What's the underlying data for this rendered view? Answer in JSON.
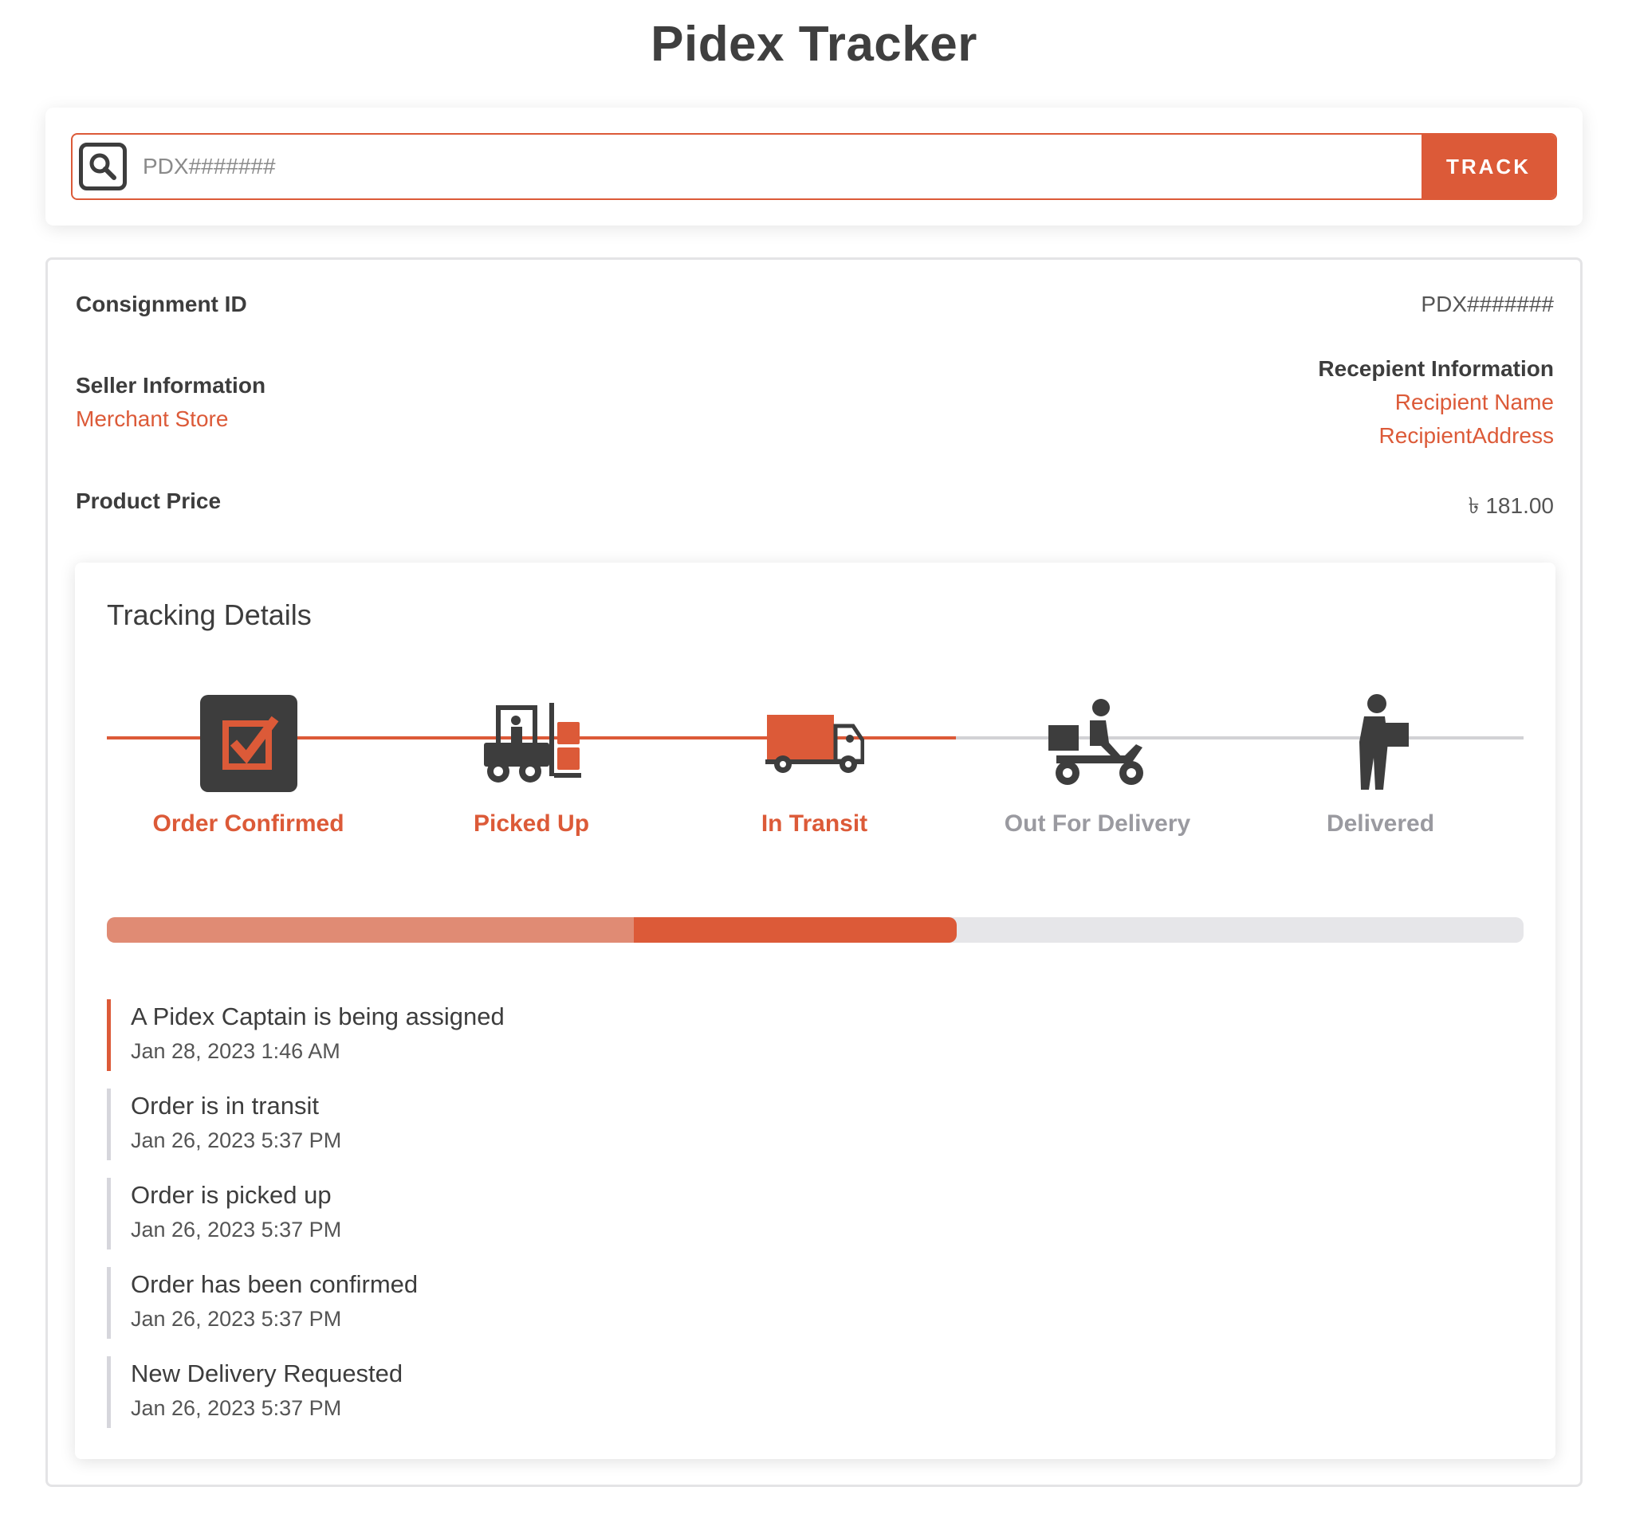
{
  "app": {
    "title": "Pidex Tracker"
  },
  "search": {
    "placeholder": "PDX#######",
    "button_label": "TRACK"
  },
  "details": {
    "consignment_label": "Consignment ID",
    "consignment_value": "PDX#######",
    "seller_label": "Seller Information",
    "seller_name": "Merchant Store",
    "recipient_label": "Recepient Information",
    "recipient_name": "Recipient Name",
    "recipient_address": "RecipientAddress",
    "price_label": "Product Price",
    "price_value": "৳ 181.00"
  },
  "tracking": {
    "title": "Tracking Details",
    "steps": [
      {
        "label": "Order Confirmed",
        "icon": "checkbox-icon",
        "active": true
      },
      {
        "label": "Picked Up",
        "icon": "forklift-icon",
        "active": true
      },
      {
        "label": "In Transit",
        "icon": "truck-icon",
        "active": true
      },
      {
        "label": "Out For Delivery",
        "icon": "scooter-icon",
        "active": false
      },
      {
        "label": "Delivered",
        "icon": "person-box-icon",
        "active": false
      }
    ],
    "progress": {
      "completed_fraction": 0.6,
      "previous_fraction": 0.372
    },
    "history": [
      {
        "title": "A Pidex Captain is being assigned",
        "time": "Jan 28, 2023 1:46 AM"
      },
      {
        "title": "Order is in transit",
        "time": "Jan 26, 2023 5:37 PM"
      },
      {
        "title": "Order is picked up",
        "time": "Jan 26, 2023 5:37 PM"
      },
      {
        "title": "Order has been confirmed",
        "time": "Jan 26, 2023 5:37 PM"
      },
      {
        "title": "New Delivery Requested",
        "time": "Jan 26, 2023 5:37 PM"
      }
    ]
  },
  "colors": {
    "accent": "#dc5a38",
    "accent_light": "#e08b74",
    "dark": "#3d3d3d",
    "muted": "#9a9aa0"
  }
}
